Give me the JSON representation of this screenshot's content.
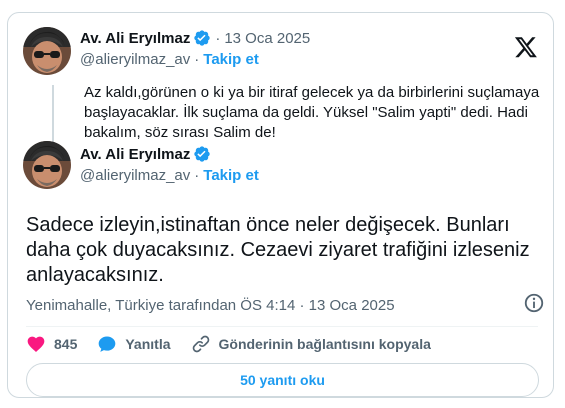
{
  "quoted_tweet": {
    "author_name": "Av. Ali Eryılmaz",
    "separator": "·",
    "date": "13 Oca 2025",
    "handle": "@alieryilmaz_av",
    "follow_label": "Takip et",
    "text": "Az kaldı,görünen o ki ya bir itiraf gelecek ya da birbirlerini suçlamaya başlayacaklar. İlk suçlama da geldi. Yüksel \"Salim yapti\" dedi. Hadi bakalım, söz sırası Salim de!"
  },
  "main_tweet": {
    "author_name": "Av. Ali Eryılmaz",
    "handle": "@alieryilmaz_av",
    "separator": "·",
    "follow_label": "Takip et",
    "text": "Sadece izleyin,istinaftan önce neler değişecek. Bunları daha çok duyacaksınız. Cezaevi ziyaret trafiğini izleseniz anlayacaksınız.",
    "meta": "Yenimahalle, Türkiye tarafından ÖS 4:14 · 13 Oca 2025"
  },
  "actions": {
    "like_count": "845",
    "reply_label": "Yanıtla",
    "copy_link_label": "Gönderinin bağlantısını kopyala"
  },
  "read_replies_label": "50 yanıtı oku",
  "colors": {
    "accent": "#1d9bf0",
    "like": "#f91880",
    "text": "#0f1419",
    "muted": "#536471",
    "border": "#cfd9de"
  },
  "icons": [
    "x-logo-icon",
    "verified-badge-icon",
    "info-icon",
    "heart-icon",
    "reply-bubble-icon",
    "link-icon"
  ]
}
